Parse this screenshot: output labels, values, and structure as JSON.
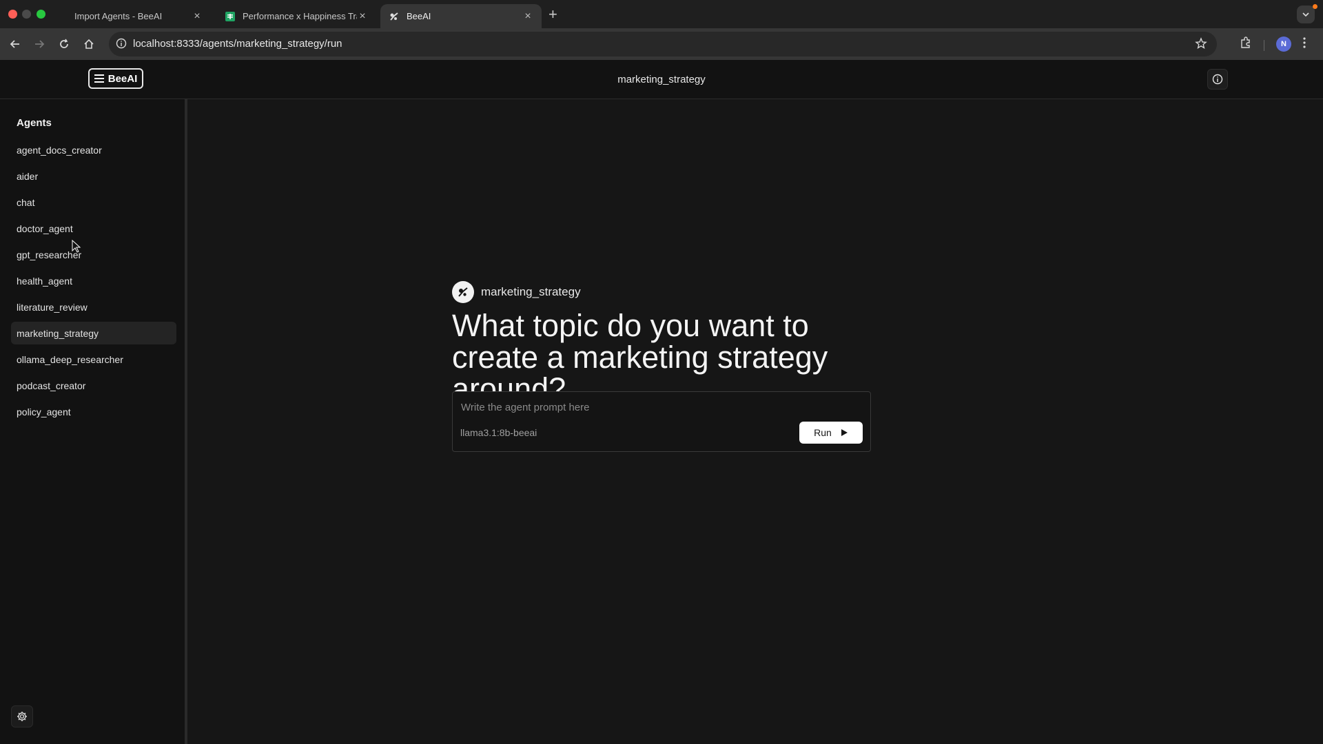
{
  "browser": {
    "tabs": [
      {
        "title": "Import Agents - BeeAI",
        "active": false
      },
      {
        "title": "Performance x Happiness Tra",
        "active": false
      },
      {
        "title": "BeeAI",
        "active": true
      }
    ],
    "url": "localhost:8333/agents/marketing_strategy/run",
    "profile_initial": "N"
  },
  "app": {
    "logo_text": "BeeAI",
    "page_title": "marketing_strategy"
  },
  "sidebar": {
    "heading": "Agents",
    "items": [
      {
        "label": "agent_docs_creator",
        "active": false
      },
      {
        "label": "aider",
        "active": false
      },
      {
        "label": "chat",
        "active": false
      },
      {
        "label": "doctor_agent",
        "active": false
      },
      {
        "label": "gpt_researcher",
        "active": false
      },
      {
        "label": "health_agent",
        "active": false
      },
      {
        "label": "literature_review",
        "active": false
      },
      {
        "label": "marketing_strategy",
        "active": true
      },
      {
        "label": "ollama_deep_researcher",
        "active": false
      },
      {
        "label": "podcast_creator",
        "active": false
      },
      {
        "label": "policy_agent",
        "active": false
      }
    ]
  },
  "main": {
    "agent_name": "marketing_strategy",
    "heading": "What topic do you want to create a marketing strategy around?",
    "prompt_placeholder": "Write the agent prompt here",
    "prompt_value": "",
    "model": "llama3.1:8b-beeai",
    "run_label": "Run"
  },
  "colors": {
    "background": "#161616",
    "sidebar_bg": "#121212",
    "active_item_bg": "#242424",
    "run_button_bg": "#ffffff",
    "sheets_green": "#1fa463"
  }
}
